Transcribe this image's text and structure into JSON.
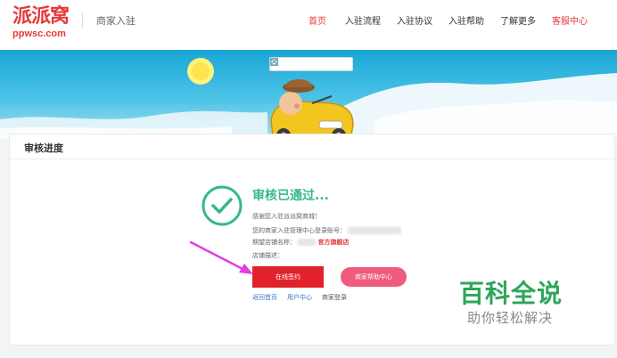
{
  "header": {
    "logo_text": "派派窝",
    "logo_domain": "ppwsc.com",
    "subtitle": "商家入驻",
    "nav": [
      {
        "label": "首页"
      },
      {
        "label": "入驻流程"
      },
      {
        "label": "入驻协议"
      },
      {
        "label": "入驻帮助"
      },
      {
        "label": "了解更多"
      },
      {
        "label": "客服中心"
      }
    ]
  },
  "toolbar": {
    "icons": [
      "image-icon",
      "expand-icon",
      "document-icon",
      "export-icon",
      "settings-icon"
    ]
  },
  "card": {
    "title": "审核进度",
    "status_title": "审核已通过...",
    "thanks": "感谢您入驻派派窝商城！",
    "account_label": "您的商家入驻管理中心登录账号：",
    "store_name_label": "期望店铺名称：",
    "store_name_suffix": "官方旗舰店",
    "store_desc_label": "店铺描述："
  },
  "actions": {
    "sign_label": "在线签约",
    "help_label": "商家帮助中心",
    "links": [
      "返回首页",
      "用户中心",
      "商家登录"
    ]
  },
  "watermark": {
    "title": "百科全说",
    "subtitle": "助你轻松解决"
  },
  "colors": {
    "brand_red": "#e4393c",
    "success_green": "#37b888",
    "sky_blue": "#1aa6d6",
    "help_pink": "#ef5b7d",
    "arrow_magenta": "#e23ce6",
    "watermark_green": "#2fa55a"
  }
}
